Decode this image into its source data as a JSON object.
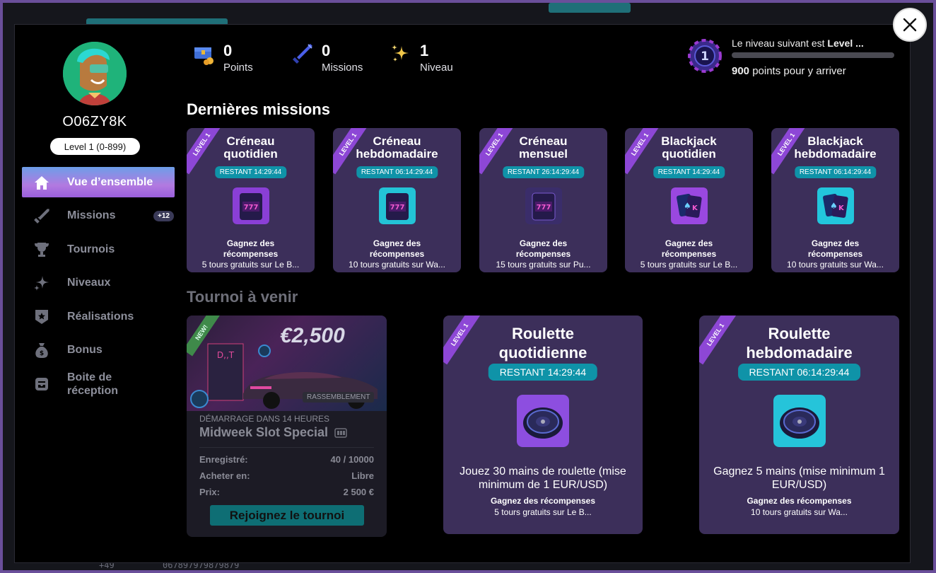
{
  "background": {
    "phone_code": "+49",
    "phone_number": "067897979879879"
  },
  "profile": {
    "username": "O06ZY8K",
    "level_pill": "Level 1 (0-899)"
  },
  "nav": {
    "items": [
      {
        "label": "Vue d’ensemble",
        "icon": "home-icon",
        "active": true
      },
      {
        "label": "Missions",
        "icon": "sword-icon",
        "badge": "+12"
      },
      {
        "label": "Tournois",
        "icon": "trophy-icon"
      },
      {
        "label": "Niveaux",
        "icon": "sparkle-icon"
      },
      {
        "label": "Réalisations",
        "icon": "badge-icon"
      },
      {
        "label": "Bonus",
        "icon": "money-bag-icon"
      },
      {
        "label": "Boite de réception",
        "icon": "inbox-icon"
      }
    ]
  },
  "stats": {
    "points": {
      "value": "0",
      "label": "Points",
      "icon": "treasure-chest-icon"
    },
    "missions": {
      "value": "0",
      "label": "Missions",
      "icon": "sword-icon"
    },
    "level": {
      "value": "1",
      "label": "Niveau",
      "icon": "sparkles-icon"
    }
  },
  "next_level": {
    "prefix": "Le niveau suivant est ",
    "target": "Level ...",
    "badge": "1",
    "progress": 0,
    "points_value": "900",
    "points_suffix": " points pour y arriver"
  },
  "sections": {
    "missions_title": "Dernières missions",
    "tournament_title": "Tournoi à venir"
  },
  "mission_cards": [
    {
      "ribbon": "LEVEL 1",
      "title": "Créneau\nquotidien",
      "timer": "RESTANT 14:29:44",
      "reward": "Gagnez des\nrécompenses",
      "sub": "5 tours gratuits sur Le B...",
      "color": "#8a3fd6"
    },
    {
      "ribbon": "LEVEL 1",
      "title": "Créneau\nhebdomadaire",
      "timer": "RESTANT 06:14:29:44",
      "reward": "Gagnez des\nrécompenses",
      "sub": "10 tours gratuits sur Wa...",
      "color": "#23c3d6"
    },
    {
      "ribbon": "LEVEL 1",
      "title": "Créneau\nmensuel",
      "timer": "RESTANT 26:14:29:44",
      "reward": "Gagnez des\nrécompenses",
      "sub": "15 tours gratuits sur Pu...",
      "color": "#3a2d6a"
    },
    {
      "ribbon": "LEVEL 1",
      "title": "Blackjack\nquotidien",
      "timer": "RESTANT 14:29:44",
      "reward": "Gagnez des\nrécompenses",
      "sub": "5 tours gratuits sur Le B...",
      "color": "#9a48e0"
    },
    {
      "ribbon": "LEVEL 1",
      "title": "Blackjack\nhebdomadaire",
      "timer": "RESTANT 06:14:29:44",
      "reward": "Gagnez des\nrécompenses",
      "sub": "10 tours gratuits sur Wa...",
      "color": "#22c6dc"
    }
  ],
  "tournament": {
    "badge": "NEW!",
    "amount": "€2,500",
    "tag": "RASSEMBLEMENT",
    "start": "DÉMARRAGE DANS 14 HEURES",
    "name": "Midweek Slot Special",
    "registered_label": "Enregistré:",
    "registered_value": "40 / 10000",
    "buyin_label": "Acheter en:",
    "buyin_value": "Libre",
    "prize_label": "Prix:",
    "prize_value": "2 500 €",
    "join_label": "Rejoignez le tournoi"
  },
  "large_cards": [
    {
      "ribbon": "LEVEL 1",
      "title": "Roulette\nquotidienne",
      "timer": "RESTANT 14:29:44",
      "desc": "Jouez 30 mains de roulette (mise minimum de 1 EUR/USD)",
      "reward": "Gagnez des récompenses",
      "sub": "5 tours gratuits sur Le B...",
      "color": "#8d4ee0"
    },
    {
      "ribbon": "LEVEL 1",
      "title": "Roulette\nhebdomadaire",
      "timer": "RESTANT 06:14:29:44",
      "desc": "Gagnez 5 mains (mise minimum 1 EUR/USD)",
      "reward": "Gagnez des récompenses",
      "sub": "10 tours gratuits sur Wa...",
      "color": "#25c4da"
    }
  ]
}
